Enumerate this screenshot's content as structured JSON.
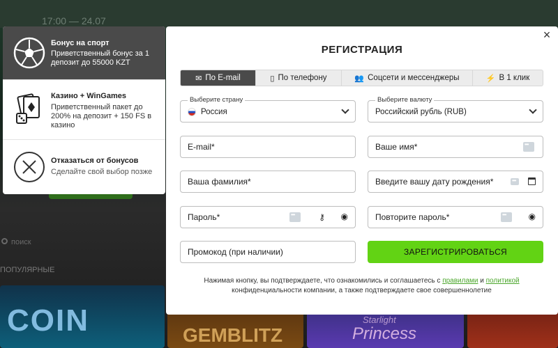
{
  "background": {
    "date_text": "17:00 — 24.07",
    "search_placeholder": "поиск",
    "popular_label": "ПОПУЛЯРНЫЕ",
    "tiles": [
      "COIN",
      "GEMBLITZ",
      "Princess",
      "Starlight"
    ]
  },
  "bonus_panel": {
    "items": [
      {
        "title": "Бонус на спорт",
        "desc": "Приветственный бонус за 1 депозит до 55000 KZT",
        "icon": "soccer-ball-icon",
        "active": true
      },
      {
        "title": "Казино + WinGames",
        "desc": "Приветственный пакет до 200% на депозит + 150 FS в казино",
        "icon": "casino-cards-dice-icon",
        "active": false
      },
      {
        "title": "Отказаться от бонусов",
        "desc": "Сделайте свой выбор позже",
        "icon": "close-circle-icon",
        "active": false
      }
    ]
  },
  "modal": {
    "title": "РЕГИСТРАЦИЯ",
    "close_icon": "×",
    "tabs": [
      {
        "label": "По E-mail",
        "icon": "✉",
        "active": true
      },
      {
        "label": "По телефону",
        "icon": "▯",
        "active": false
      },
      {
        "label": "Соцсети и мессенджеры",
        "icon": "👥",
        "active": false
      },
      {
        "label": "В 1 клик",
        "icon": "⚡",
        "active": false
      }
    ],
    "country": {
      "legend": "Выберите страну",
      "value": "Россия"
    },
    "currency": {
      "legend": "Выберите валюту",
      "value": "Российский рубль (RUB)"
    },
    "fields": {
      "email": "E-mail*",
      "name": "Ваше имя*",
      "surname": "Ваша фамилия*",
      "birthdate": "Введите вашу дату рождения*",
      "password": "Пароль*",
      "password_repeat": "Повторите пароль*",
      "promo": "Промокод (при наличии)"
    },
    "register_button": "ЗАРЕГИСТРИРОВАТЬСЯ",
    "terms": {
      "prefix": "Нажимая кнопку, вы подтверждаете, что ознакомились и соглашаетесь с ",
      "rules_link": "правилами",
      "and": " и ",
      "policy_link": "политикой",
      "suffix": "конфиденциальности компании, а также подтверждаете свое совершеннолетие"
    }
  },
  "colors": {
    "accent_green": "#62d314",
    "active_tab": "#4a4a4a",
    "link": "#4aa62a"
  }
}
